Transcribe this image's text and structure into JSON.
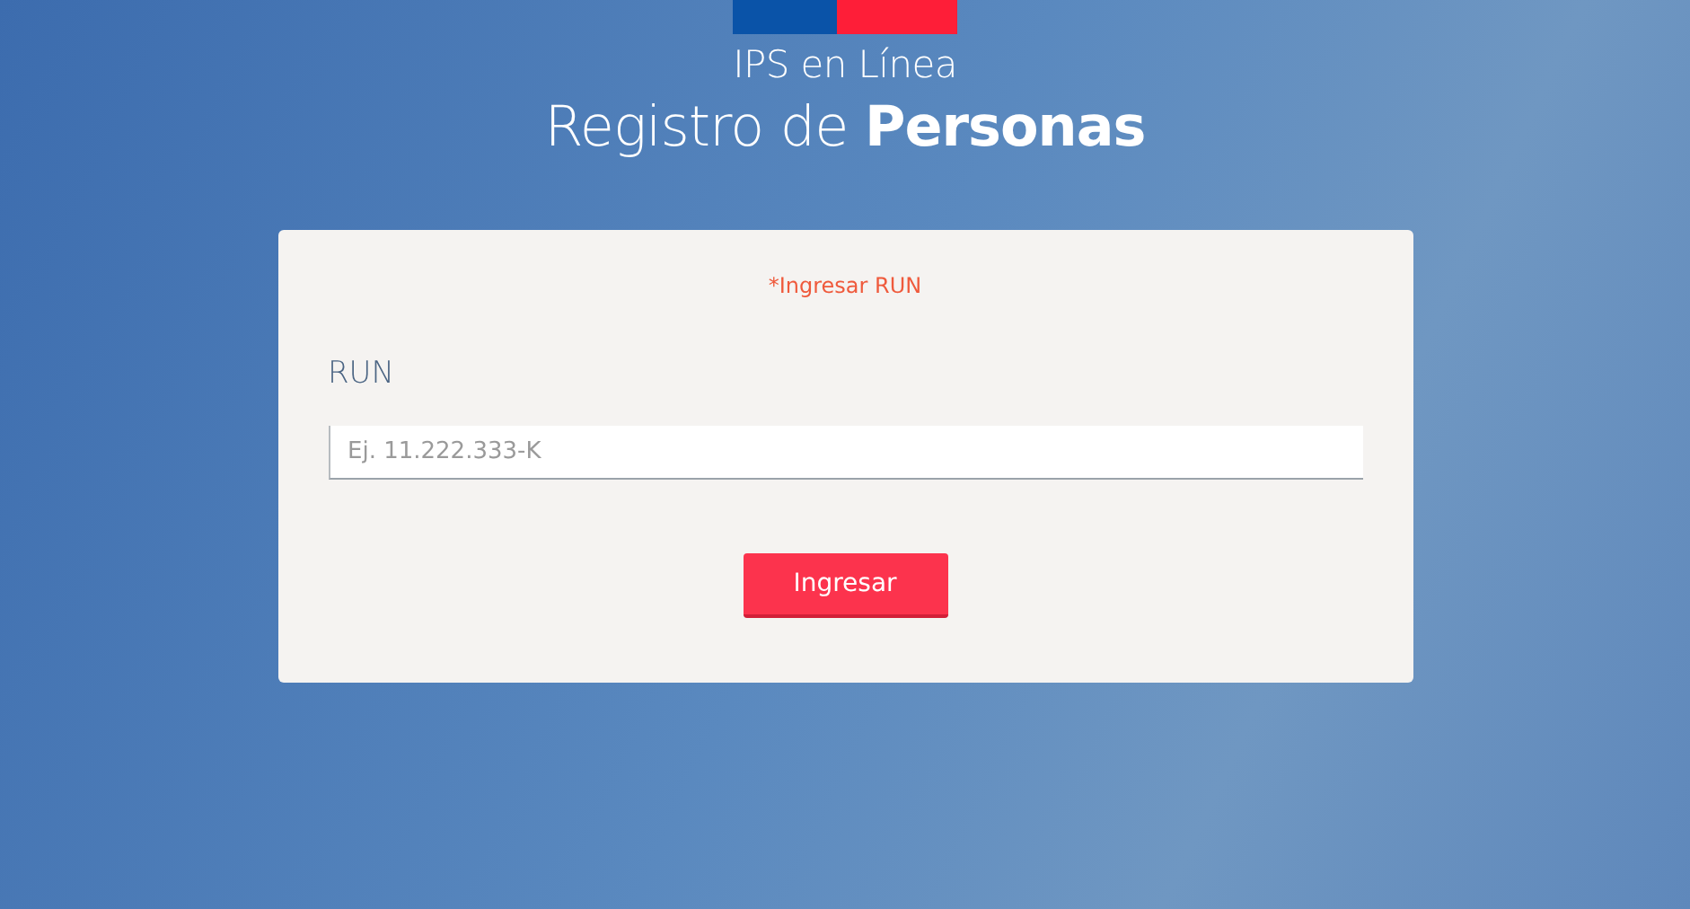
{
  "brand": {
    "name": "IPS en Línea"
  },
  "title": "Registro de **Personas**",
  "form": {
    "error": "*Ingresar RUN",
    "label": "RUN",
    "placeholder": "Ej. 11.222.333-K",
    "button": "Ingresar"
  }
}
